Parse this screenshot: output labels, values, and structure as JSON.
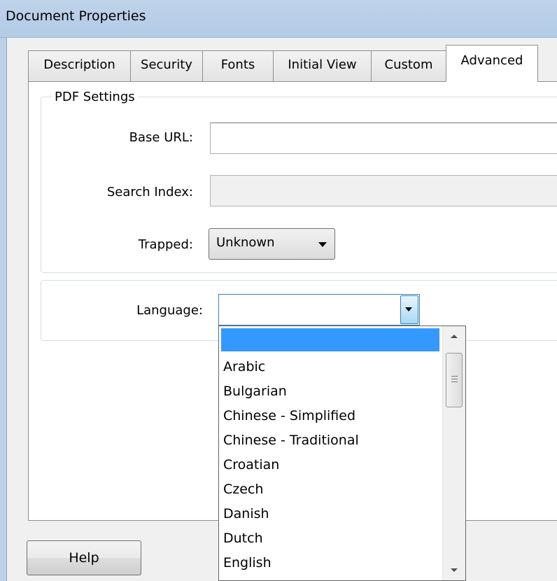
{
  "window": {
    "title": "Document Properties"
  },
  "tabs": [
    {
      "label": "Description",
      "active": false
    },
    {
      "label": "Security",
      "active": false
    },
    {
      "label": "Fonts",
      "active": false
    },
    {
      "label": "Initial View",
      "active": false
    },
    {
      "label": "Custom",
      "active": false
    },
    {
      "label": "Advanced",
      "active": true
    }
  ],
  "pdf_settings": {
    "group_label": "PDF Settings",
    "base_url": {
      "label": "Base URL:",
      "value": ""
    },
    "search_index": {
      "label": "Search Index:",
      "value": ""
    },
    "trapped": {
      "label": "Trapped:",
      "value": "Unknown"
    }
  },
  "language": {
    "label": "Language:",
    "value": "",
    "options": [
      "",
      "Arabic",
      "Bulgarian",
      "Chinese - Simplified",
      "Chinese - Traditional",
      "Croatian",
      "Czech",
      "Danish",
      "Dutch",
      "English"
    ]
  },
  "buttons": {
    "help": "Help"
  },
  "colors": {
    "selection": "#3399ff",
    "titlebar": "#bfd3ea",
    "focus_border": "#3c7fb1"
  }
}
